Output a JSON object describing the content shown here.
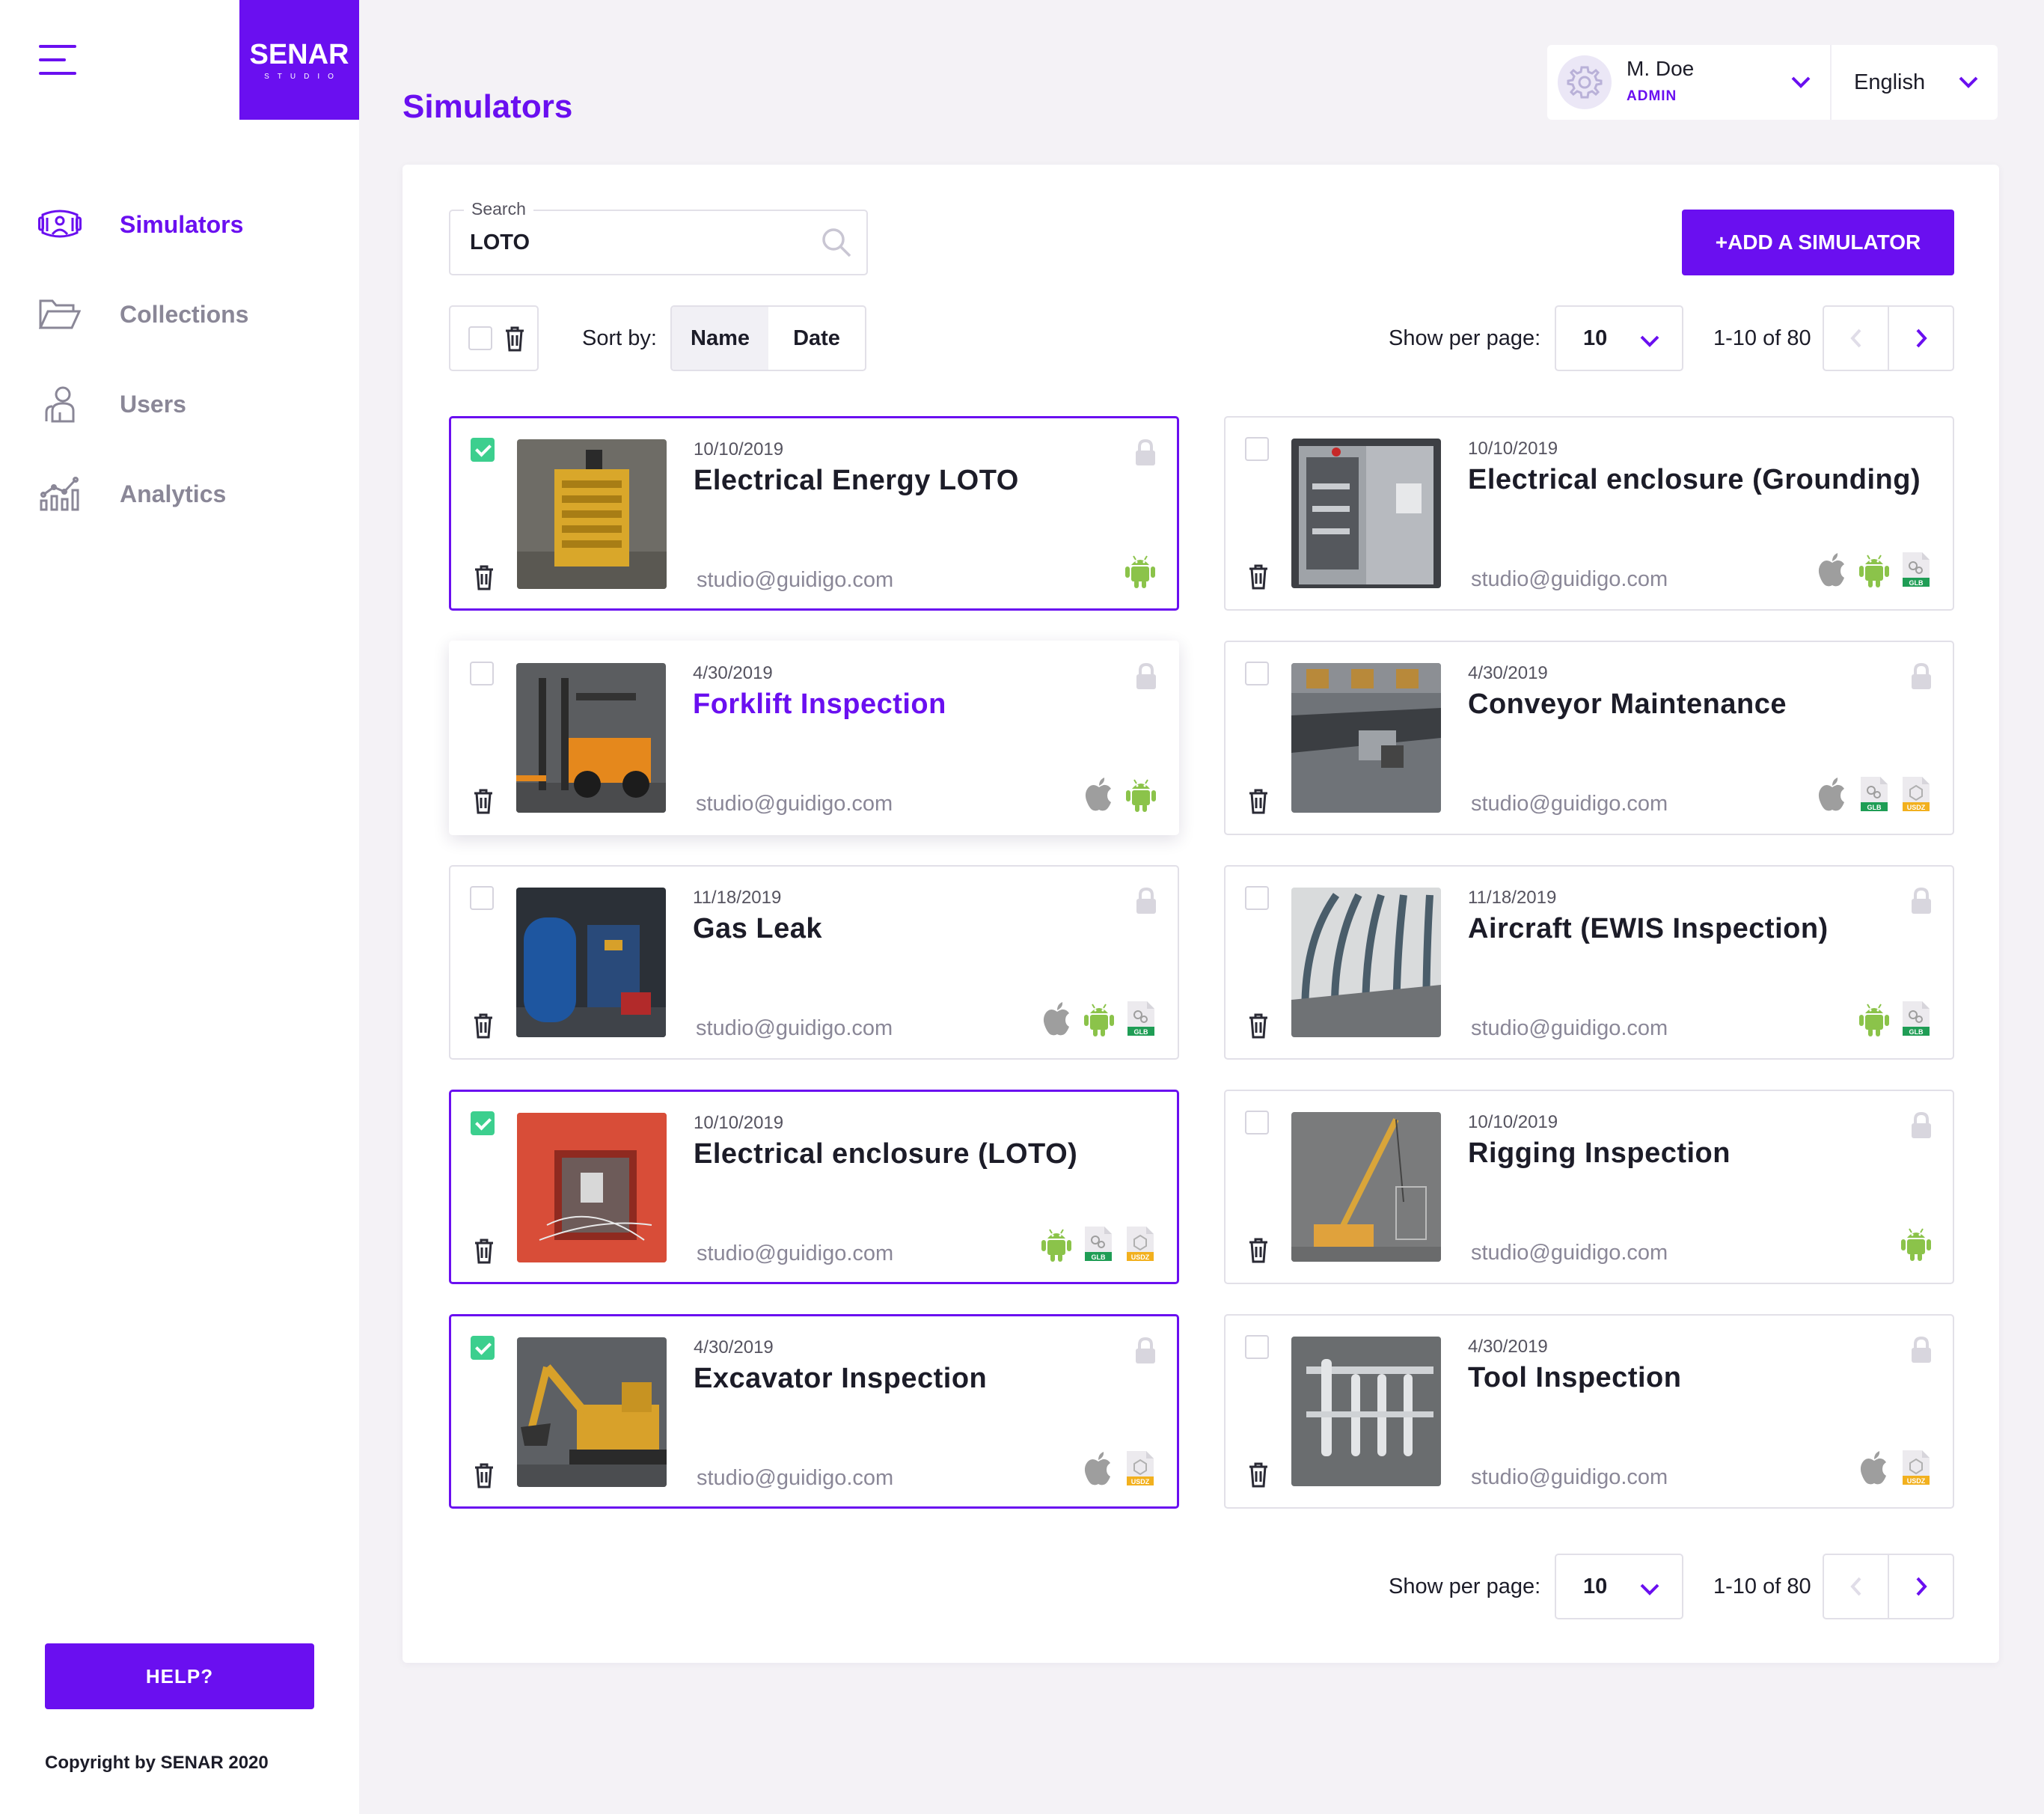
{
  "brand": {
    "name": "SENAR",
    "sub": "STUDIO"
  },
  "nav": {
    "items": [
      {
        "label": "Simulators",
        "icon": "simulator-headset-icon",
        "active": true
      },
      {
        "label": "Collections",
        "icon": "folder-icon",
        "active": false
      },
      {
        "label": "Users",
        "icon": "users-icon",
        "active": false
      },
      {
        "label": "Analytics",
        "icon": "analytics-chart-icon",
        "active": false
      }
    ]
  },
  "help_label": "HELP?",
  "copyright": "Copyright by SENAR 2020",
  "page_title": "Simulators",
  "user": {
    "name": "M. Doe",
    "role": "ADMIN"
  },
  "language": "English",
  "search": {
    "legend": "Search",
    "value": "LOTO"
  },
  "add_button": "+ADD A SIMULATOR",
  "sort": {
    "label": "Sort by:",
    "options": [
      "Name",
      "Date"
    ],
    "active": "Name"
  },
  "pagination": {
    "label": "Show per page:",
    "per_page": "10",
    "range": "1-10 of 80"
  },
  "colors": {
    "accent": "#6a0ff0",
    "check": "#3ccf8e",
    "android": "#8bc34a",
    "apple": "#9e9e9e",
    "glb": "#1f9d55",
    "usdz": "#f2b01e"
  },
  "simulators": [
    {
      "date": "10/10/2019",
      "title": "Electrical Energy LOTO",
      "email": "studio@guidigo.com",
      "checked": true,
      "platforms": [
        "android"
      ]
    },
    {
      "date": "10/10/2019",
      "title": "Electrical enclosure (Grounding)",
      "email": "studio@guidigo.com",
      "checked": false,
      "platforms": [
        "apple",
        "android",
        "glb"
      ]
    },
    {
      "date": "4/30/2019",
      "title": "Forklift Inspection",
      "email": "studio@guidigo.com",
      "checked": false,
      "platforms": [
        "apple",
        "android"
      ]
    },
    {
      "date": "4/30/2019",
      "title": "Conveyor Maintenance",
      "email": "studio@guidigo.com",
      "checked": false,
      "platforms": [
        "apple",
        "glb",
        "usdz"
      ]
    },
    {
      "date": "11/18/2019",
      "title": "Gas Leak",
      "email": "studio@guidigo.com",
      "checked": false,
      "platforms": [
        "apple",
        "android",
        "glb"
      ]
    },
    {
      "date": "11/18/2019",
      "title": "Aircraft (EWIS Inspection)",
      "email": "studio@guidigo.com",
      "checked": false,
      "platforms": [
        "android",
        "glb"
      ]
    },
    {
      "date": "10/10/2019",
      "title": "Electrical enclosure (LOTO)",
      "email": "studio@guidigo.com",
      "checked": true,
      "platforms": [
        "android",
        "glb",
        "usdz"
      ]
    },
    {
      "date": "10/10/2019",
      "title": "Rigging Inspection",
      "email": "studio@guidigo.com",
      "checked": false,
      "platforms": [
        "android"
      ]
    },
    {
      "date": "4/30/2019",
      "title": "Excavator Inspection",
      "email": "studio@guidigo.com",
      "checked": true,
      "platforms": [
        "apple",
        "usdz"
      ]
    },
    {
      "date": "4/30/2019",
      "title": "Tool Inspection",
      "email": "studio@guidigo.com",
      "checked": false,
      "platforms": [
        "apple",
        "usdz"
      ]
    }
  ]
}
